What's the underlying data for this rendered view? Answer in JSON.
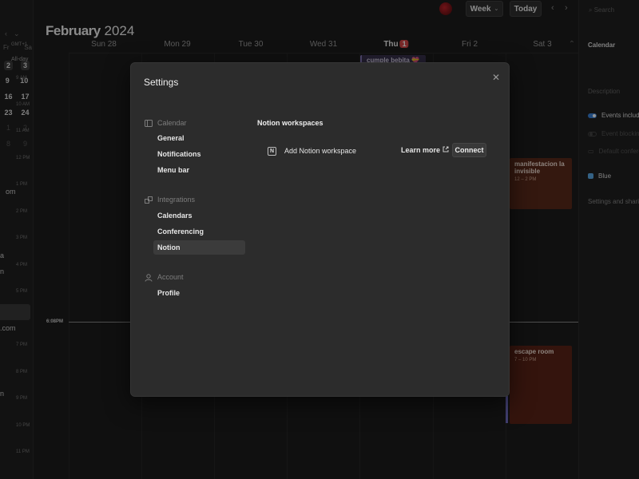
{
  "sidebar": {
    "weekday_headers": [
      "Fr",
      "Sa"
    ],
    "mini_days": [
      [
        "2",
        "3"
      ],
      [
        "9",
        "10"
      ],
      [
        "16",
        "17"
      ],
      [
        "23",
        "24"
      ],
      [
        "1",
        "2"
      ],
      [
        "8",
        "9"
      ]
    ],
    "fragments": [
      "om",
      "a",
      "n",
      ".com",
      "n"
    ]
  },
  "header": {
    "month": "February",
    "year": "2024",
    "week_button": "Week",
    "today_button": "Today",
    "search_placeholder": "Search"
  },
  "calendar": {
    "gmt_label": "GMT+1",
    "all_day_label": "All-day",
    "days": [
      {
        "label": "Sun 28"
      },
      {
        "label": "Mon 29"
      },
      {
        "label": "Tue 30"
      },
      {
        "label": "Wed 31"
      },
      {
        "label": "Thu",
        "badge": "1"
      },
      {
        "label": "Fri 2"
      },
      {
        "label": "Sat 3"
      }
    ],
    "hours": [
      "9 AM",
      "10 AM",
      "11 AM",
      "12 PM",
      "1 PM",
      "2 PM",
      "3 PM",
      "4 PM",
      "5 PM",
      "6 PM",
      "7 PM",
      "8 PM",
      "9 PM",
      "10 PM",
      "11 PM"
    ],
    "current_time": "6:08PM",
    "events": {
      "cumple": {
        "title": "cumple bebita 💝"
      },
      "manifestacion": {
        "title": "manifestacion la invisible",
        "time": "12 – 2 PM"
      },
      "escape": {
        "title": "escape room",
        "time": "7 – 10 PM"
      }
    }
  },
  "right_panel": {
    "title": "Calendar",
    "description_placeholder": "Description",
    "events_included": "Events included",
    "event_blocking": "Event blocking",
    "default_conferencing": "Default conferencing",
    "color_name": "Blue",
    "color_hex": "#5aa9e6",
    "settings_share": "Settings and sharing"
  },
  "modal": {
    "title": "Settings",
    "close_icon": "close-icon",
    "sections": [
      {
        "title": "Calendar",
        "icon": "calendar-icon",
        "items": [
          "General",
          "Notifications",
          "Menu bar"
        ]
      },
      {
        "title": "Integrations",
        "icon": "integrations-icon",
        "items": [
          "Calendars",
          "Conferencing",
          "Notion"
        ]
      },
      {
        "title": "Account",
        "icon": "account-icon",
        "items": [
          "Profile"
        ]
      }
    ],
    "active_item": "Notion",
    "content": {
      "title": "Notion workspaces",
      "add_label": "Add Notion workspace",
      "learn_more": "Learn more",
      "connect": "Connect"
    }
  }
}
